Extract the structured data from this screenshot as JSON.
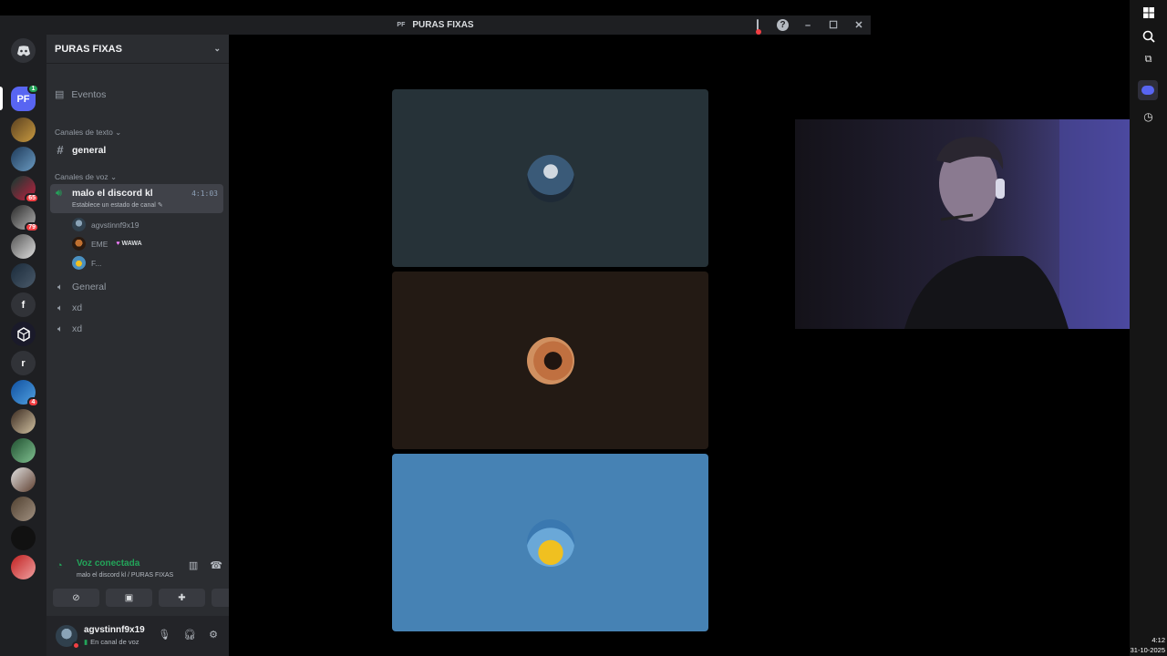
{
  "window": {
    "title": "PURAS FIXAS",
    "title_mark": "PF"
  },
  "server": {
    "name": "PURAS FIXAS",
    "icon_label": "PF",
    "icon_badge": "1"
  },
  "rail": {
    "badges": {
      "b1": "65",
      "b2": "79",
      "b3": "4"
    },
    "letters": {
      "l1": "f",
      "l2": "r"
    }
  },
  "sidebar": {
    "events_label": "Eventos",
    "text_category": "Canales de texto",
    "text_channels": [
      {
        "name": "general"
      }
    ],
    "voice_category": "Canales de voz",
    "active_voice": {
      "name": "malo el discord kl",
      "status": "Establece un estado de canal",
      "timer": "4:1:03"
    },
    "members": [
      {
        "name": "agvstinnf9x19"
      },
      {
        "name": "EME",
        "tag": "WAWA"
      },
      {
        "name": "F..."
      }
    ],
    "voice_channels": [
      {
        "name": "General"
      },
      {
        "name": "xd"
      },
      {
        "name": "xd"
      }
    ]
  },
  "voice_panel": {
    "status": "Voz conectada",
    "location": "malo el discord kl / PURAS FIXAS"
  },
  "user": {
    "name": "agvstinnf9x19",
    "status": "En canal de voz"
  },
  "clock": {
    "time": "4:12",
    "date": "31-10-2025"
  },
  "colors": {
    "accent": "#5865f2",
    "connected": "#23a55a",
    "tile1": "#263238",
    "tile2": "#231a14",
    "tile3": "#4682b4"
  }
}
